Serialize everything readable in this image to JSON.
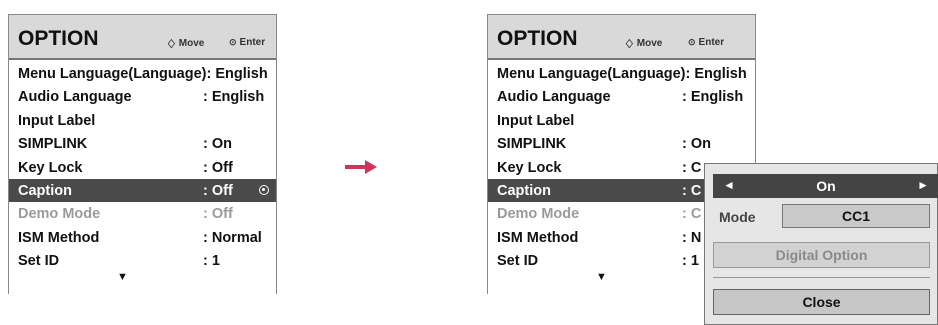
{
  "left_menu": {
    "title": "OPTION",
    "move_icon": "♢",
    "move_label": "Move",
    "enter_icon": "⊙",
    "enter_label": "Enter",
    "items": [
      {
        "label": "Menu Language(Language): English",
        "value": ""
      },
      {
        "label": "Audio Language",
        "value": ": English"
      },
      {
        "label": "Input Label",
        "value": ""
      },
      {
        "label": "SIMPLINK",
        "value": ": On"
      },
      {
        "label": "Key Lock",
        "value": ": Off"
      },
      {
        "label": "Caption",
        "value": ": Off"
      },
      {
        "label": "Demo Mode",
        "value": ": Off"
      },
      {
        "label": "ISM Method",
        "value": ": Normal"
      },
      {
        "label": "Set ID",
        "value": ": 1"
      }
    ],
    "scroll_down_icon": "▼"
  },
  "right_menu": {
    "title": "OPTION",
    "move_icon": "♢",
    "move_label": "Move",
    "enter_icon": "⊙",
    "enter_label": "Enter",
    "items": [
      {
        "label": "Menu Language(Language): English",
        "value": ""
      },
      {
        "label": "Audio Language",
        "value": ": English"
      },
      {
        "label": "Input Label",
        "value": ""
      },
      {
        "label": "SIMPLINK",
        "value": ": On"
      },
      {
        "label": "Key Lock",
        "value": ": C"
      },
      {
        "label": "Caption",
        "value": ": C"
      },
      {
        "label": "Demo Mode",
        "value": ": C"
      },
      {
        "label": "ISM Method",
        "value": ": N"
      },
      {
        "label": "Set ID",
        "value": ": 1"
      }
    ],
    "scroll_down_icon": "▼"
  },
  "caption_popup": {
    "left_arrow": "◄",
    "right_arrow": "►",
    "value": "On",
    "mode_label": "Mode",
    "mode_value": "CC1",
    "digital_option": "Digital Option",
    "close": "Close"
  },
  "colors": {
    "transition_arrow": "#d2335c",
    "selected_row": "#4a4a4a",
    "header_bg": "#d9d9d9"
  }
}
